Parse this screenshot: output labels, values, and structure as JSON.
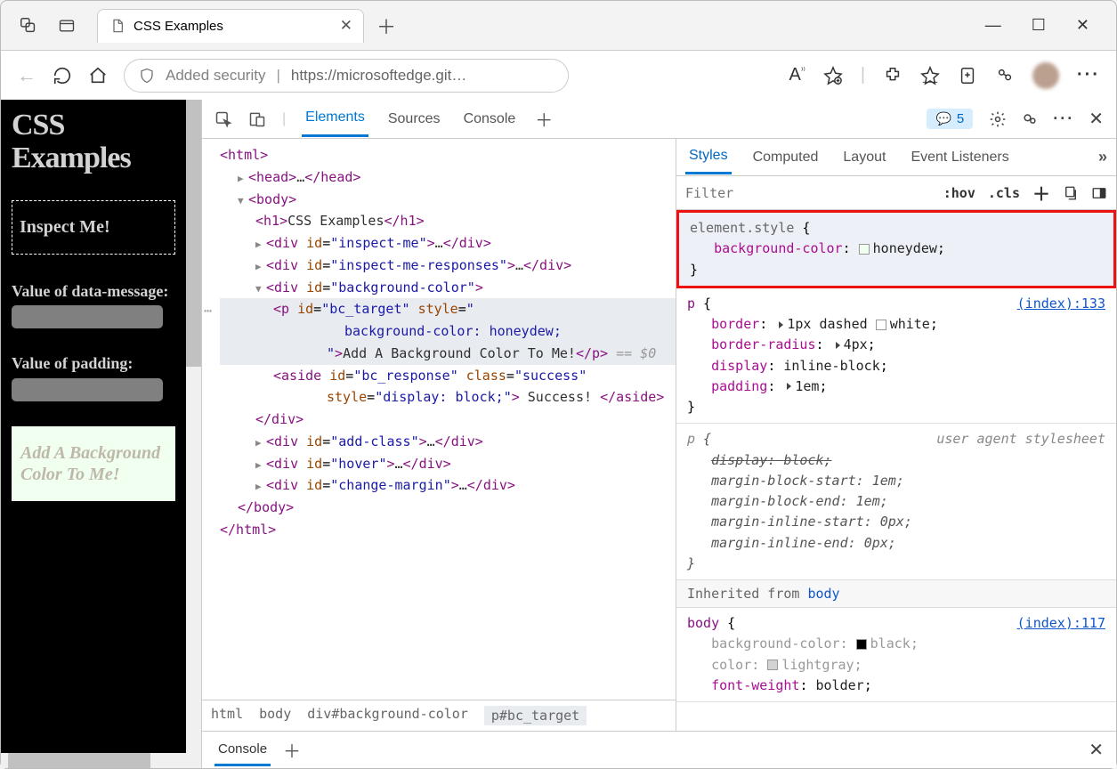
{
  "browser": {
    "tab_title": "CSS Examples",
    "address": {
      "security_label": "Added security",
      "url": "https://microsoftedge.git…"
    }
  },
  "page": {
    "heading": "CSS Examples",
    "inspect_box": "Inspect Me!",
    "label_data_message": "Value of data-message:",
    "label_padding": "Value of padding:",
    "bg_card": "Add A Background Color To Me!"
  },
  "devtools": {
    "tabs": {
      "elements": "Elements",
      "sources": "Sources",
      "console": "Console"
    },
    "issues_count": "5",
    "dom": {
      "html_open": "<html>",
      "head": "<head>…</head>",
      "body_open": "<body>",
      "h1": "CSS Examples",
      "div_inspect_me": {
        "id": "inspect-me"
      },
      "div_inspect_resp": {
        "id": "inspect-me-responses"
      },
      "div_bgcolor": {
        "id": "background-color"
      },
      "p_target": {
        "id": "bc_target",
        "style_prop": "background-color",
        "style_val": "honeydew",
        "text": "Add A Background Color To Me!",
        "marker": "== $0"
      },
      "aside": {
        "id": "bc_response",
        "class": "success",
        "style": "display: block;",
        "text": " Success! "
      },
      "div_addclass": {
        "id": "add-class"
      },
      "div_hover": {
        "id": "hover"
      },
      "div_changemargin": {
        "id": "change-margin"
      },
      "body_close": "</body>",
      "html_close": "</html>"
    },
    "breadcrumbs": [
      "html",
      "body",
      "div#background-color",
      "p#bc_target"
    ],
    "styles": {
      "tabs": {
        "styles": "Styles",
        "computed": "Computed",
        "layout": "Layout",
        "event": "Event Listeners"
      },
      "filter_placeholder": "Filter",
      "hov": ":hov",
      "cls": ".cls",
      "rule1": {
        "sel": "element.style",
        "prop": "background-color",
        "val": "honeydew"
      },
      "rule2": {
        "sel": "p",
        "link": "(index):133",
        "p1": "border",
        "v1": "1px dashed ",
        "v1c": "white",
        "p2": "border-radius",
        "v2": "4px",
        "p3": "display",
        "v3": "inline-block",
        "p4": "padding",
        "v4": "1em"
      },
      "rule3": {
        "sel": "p",
        "ua": "user agent stylesheet",
        "p1": "display",
        "v1": "block",
        "p2": "margin-block-start",
        "v2": "1em",
        "p3": "margin-block-end",
        "v3": "1em",
        "p4": "margin-inline-start",
        "v4": "0px",
        "p5": "margin-inline-end",
        "v5": "0px"
      },
      "inherited": "Inherited from ",
      "inherited_sel": "body",
      "rule4": {
        "sel": "body",
        "link": "(index):117",
        "p1": "background-color",
        "v1": "black",
        "p2": "color",
        "v2": "lightgray",
        "p3": "font-weight",
        "v3": "bolder"
      }
    },
    "console_drawer": "Console"
  }
}
